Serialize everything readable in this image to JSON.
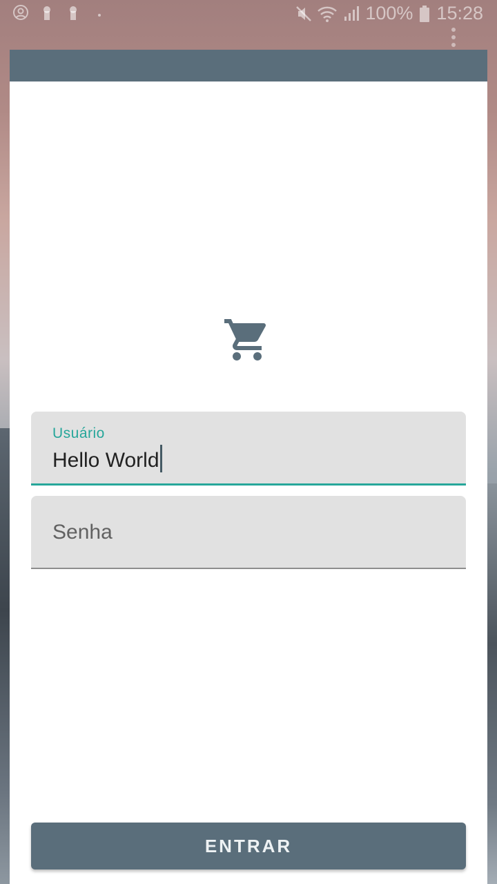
{
  "status_bar": {
    "battery": "100%",
    "time": "15:28"
  },
  "form": {
    "username": {
      "label": "Usuário",
      "value": "Hello World"
    },
    "password": {
      "placeholder": "Senha"
    },
    "submit_label": "ENTRAR"
  },
  "colors": {
    "primary": "#5a6e7b",
    "accent": "#26a69a",
    "field_bg": "#e1e1e1"
  },
  "icons": {
    "logo": "shopping-cart-icon"
  }
}
